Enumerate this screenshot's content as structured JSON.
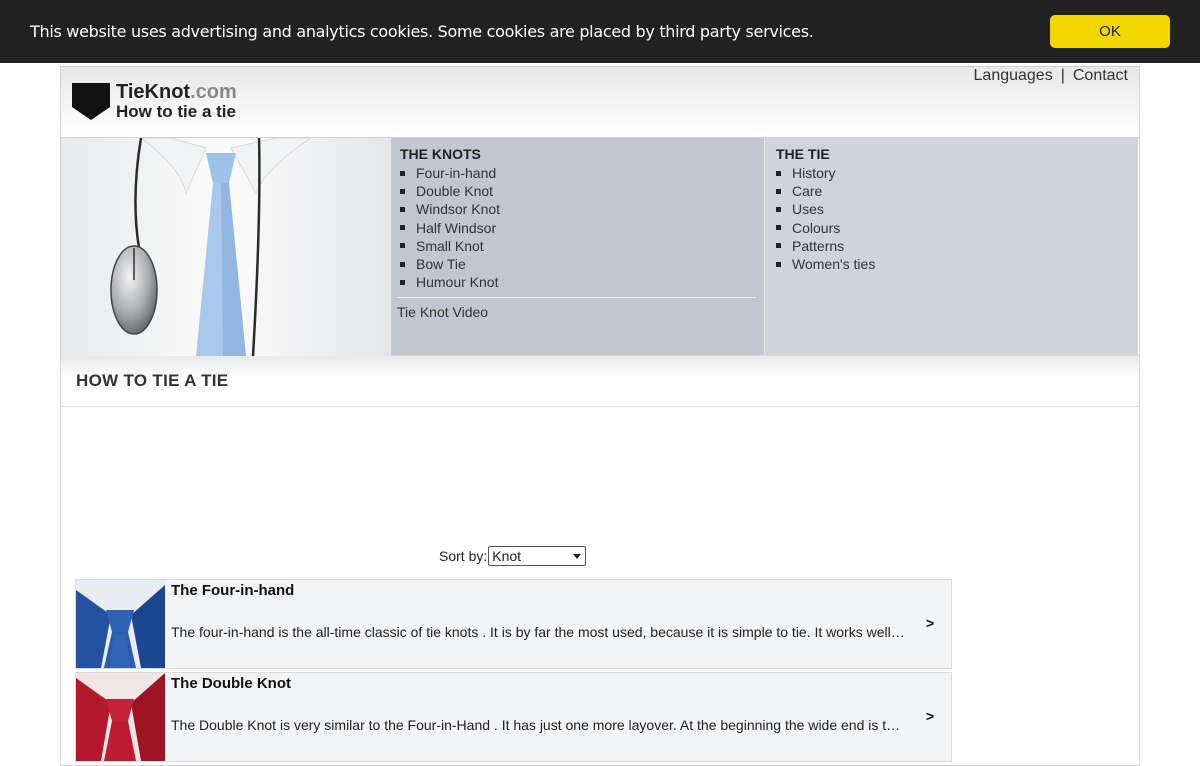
{
  "cookie": {
    "text": "This website uses advertising and analytics cookies. Some cookies are placed by third party services.",
    "ok_label": "OK",
    "bar_color": "#222222",
    "button_color": "#f1d600"
  },
  "header": {
    "logo_name": "TieKnot",
    "logo_domain": ".com",
    "tagline": "How to tie a tie",
    "links": {
      "languages": "Languages",
      "separator": "|",
      "contact": "Contact"
    }
  },
  "nav": {
    "knots": {
      "title": "THE KNOTS",
      "items": [
        "Four-in-hand",
        "Double Knot",
        "Windsor Knot",
        "Half Windsor",
        "Small Knot",
        "Bow Tie",
        "Humour Knot"
      ],
      "video_link": "Tie Knot Video"
    },
    "tie": {
      "title": "THE TIE",
      "items": [
        "History",
        "Care",
        "Uses",
        "Colours",
        "Patterns",
        "Women's ties"
      ]
    }
  },
  "main": {
    "heading": "HOW TO TIE A TIE",
    "sort_label": "Sort by:",
    "sort_value": "Knot",
    "cards": [
      {
        "title": "The Four-in-hand",
        "description": "The four-in-hand is the all-time classic of tie knots . It is by far the most used, because it is simple to tie. It works well with most dress shirts and ties.",
        "arrow": ">",
        "tie_color": "#1f4fa0"
      },
      {
        "title": "The Double Knot",
        "description": "The Double Knot is very similar to the Four-in-Hand . It has just one more layover. At the beginning the wide end is turned twice around the narrow end.",
        "arrow": ">",
        "tie_color": "#b3192a"
      }
    ]
  }
}
